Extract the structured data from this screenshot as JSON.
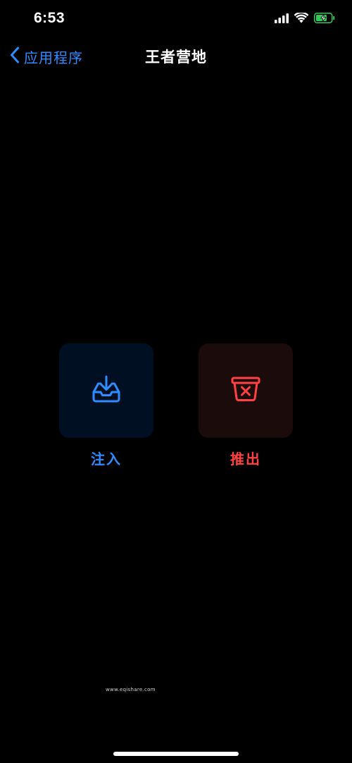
{
  "status_bar": {
    "time": "6:53",
    "icons": [
      "signal-icon",
      "wifi-icon",
      "battery-charging-icon"
    ]
  },
  "nav": {
    "back_label": "应用程序",
    "title": "王者营地"
  },
  "actions": {
    "inject": {
      "label": "注入",
      "icon": "inbox-download-icon",
      "color": "#2d8cff"
    },
    "eject": {
      "label": "推出",
      "icon": "box-remove-icon",
      "color": "#ff4141"
    }
  },
  "watermark": "www.eqishare.com",
  "colors": {
    "accent_blue": "#2d8cff",
    "accent_red": "#ff4141",
    "background": "#000000",
    "battery_green": "#34c759"
  }
}
